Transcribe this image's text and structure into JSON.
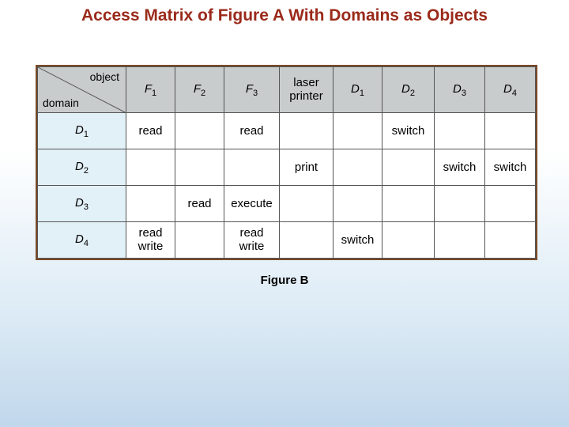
{
  "title": "Access Matrix of Figure A With Domains as Objects",
  "caption": "Figure B",
  "corner": {
    "top_label": "object",
    "bottom_label": "domain"
  },
  "columns": [
    {
      "base": "F",
      "sub": "1"
    },
    {
      "base": "F",
      "sub": "2"
    },
    {
      "base": "F",
      "sub": "3"
    },
    {
      "plain1": "laser",
      "plain2": "printer"
    },
    {
      "base": "D",
      "sub": "1"
    },
    {
      "base": "D",
      "sub": "2"
    },
    {
      "base": "D",
      "sub": "3"
    },
    {
      "base": "D",
      "sub": "4"
    }
  ],
  "rows": [
    {
      "head": {
        "base": "D",
        "sub": "1"
      },
      "cells": [
        "read",
        "",
        "read",
        "",
        "",
        "switch",
        "",
        ""
      ]
    },
    {
      "head": {
        "base": "D",
        "sub": "2"
      },
      "cells": [
        "",
        "",
        "",
        "print",
        "",
        "",
        "switch",
        "switch"
      ]
    },
    {
      "head": {
        "base": "D",
        "sub": "3"
      },
      "cells": [
        "",
        "read",
        "execute",
        "",
        "",
        "",
        "",
        ""
      ]
    },
    {
      "head": {
        "base": "D",
        "sub": "4"
      },
      "cells": [
        "read\nwrite",
        "",
        "read\nwrite",
        "",
        "switch",
        "",
        "",
        ""
      ]
    }
  ],
  "chart_data": {
    "type": "table",
    "title": "Access Matrix of Figure A With Domains as Objects",
    "row_labels": [
      "D1",
      "D2",
      "D3",
      "D4"
    ],
    "column_labels": [
      "F1",
      "F2",
      "F3",
      "laser printer",
      "D1",
      "D2",
      "D3",
      "D4"
    ],
    "cells": [
      [
        "read",
        "",
        "read",
        "",
        "",
        "switch",
        "",
        ""
      ],
      [
        "",
        "",
        "",
        "print",
        "",
        "",
        "switch",
        "switch"
      ],
      [
        "",
        "read",
        "execute",
        "",
        "",
        "",
        "",
        ""
      ],
      [
        "read write",
        "",
        "read write",
        "",
        "switch",
        "",
        "",
        ""
      ]
    ]
  }
}
